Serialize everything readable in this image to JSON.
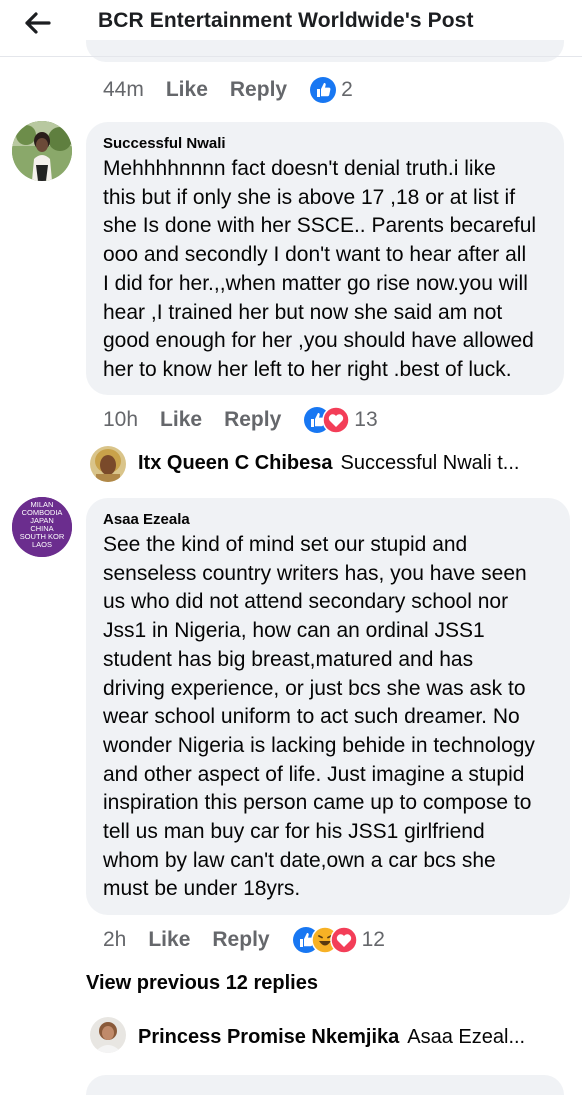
{
  "header": {
    "title": "BCR Entertainment Worldwide's Post",
    "back_icon": "back-arrow-icon"
  },
  "colors": {
    "like_blue": "#1877f2",
    "love_red": "#f33e58",
    "haha_yellow": "#f7b125",
    "bubble_bg": "#f0f2f5",
    "meta_gray": "#65676b"
  },
  "prev_comment": {
    "time": "44m",
    "like_label": "Like",
    "reply_label": "Reply",
    "reaction_count": "2",
    "reactions": [
      "like"
    ]
  },
  "comment1": {
    "author": "Successful Nwali",
    "text": "Mehhhhnnnn fact doesn't denial truth.i like\nthis  but if only she is above 17 ,18 or at list if\nshe Is done with her SSCE.. Parents becareful\nooo and secondly I don't want to hear after all\nI did for her.,,when matter go rise now.you will\nhear ,I trained her but now she said am not\ngood enough for her ,you should have allowed\nher to know her left to her right .best of luck.",
    "time": "10h",
    "like_label": "Like",
    "reply_label": "Reply",
    "reaction_count": "13",
    "reactions": [
      "like",
      "love"
    ],
    "reply": {
      "author": "Itx Queen C Chibesa",
      "snippet": "Successful Nwali t..."
    }
  },
  "comment2": {
    "author": "Asaa Ezeala",
    "avatar_text": [
      "MILAN",
      "COMBODIA",
      "JAPAN",
      "CHINA",
      "SOUTH KOR",
      "LAOS"
    ],
    "text": "See the kind of mind set our stupid and\nsenseless country writers has, you have seen\nus who did not attend secondary school nor\nJss1  in Nigeria, how can an ordinal JSS1\nstudent has big breast,matured and has\ndriving experience, or just bcs she was ask to\nwear school uniform to act such dreamer. No\nwonder Nigeria is lacking behide in technology\nand other aspect of life. Just imagine a stupid\ninspiration this person came up to compose to\ntell us man buy car for his JSS1 girlfriend\nwhom by law can't date,own a car bcs she\nmust be under 18yrs.",
    "time": "2h",
    "like_label": "Like",
    "reply_label": "Reply",
    "reaction_count": "12",
    "reactions": [
      "like",
      "haha",
      "love"
    ]
  },
  "view_previous": "View previous 12 replies",
  "last_reply": {
    "author": "Princess Promise Nkemjika",
    "snippet": "Asaa Ezeal..."
  }
}
